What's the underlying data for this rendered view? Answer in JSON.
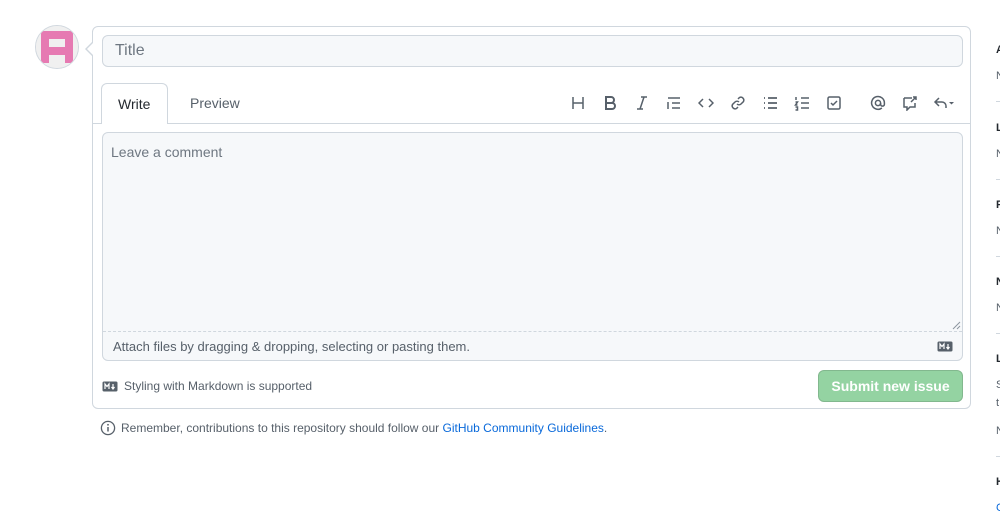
{
  "form": {
    "title_placeholder": "Title",
    "tabs": {
      "write": "Write",
      "preview": "Preview"
    },
    "toolbar_icons": [
      "heading-icon",
      "bold-icon",
      "italic-icon",
      "quote-icon",
      "code-icon",
      "link-icon",
      "unordered-list-icon",
      "ordered-list-icon",
      "task-list-icon",
      "mention-icon",
      "reference-icon",
      "reply-icon"
    ],
    "comment_placeholder": "Leave a comment",
    "attach_text": "Attach files by dragging & dropping, selecting or pasting them.",
    "markdown_hint": "Styling with Markdown is supported",
    "submit_label": "Submit new issue"
  },
  "guideline": {
    "prefix": "Remember, contributions to this repository should follow our ",
    "link": "GitHub Community Guidelines",
    "suffix": "."
  },
  "sidebar_edge": {
    "letters": [
      "A",
      "N",
      "L",
      "N",
      "P",
      "N",
      "N",
      "N",
      "L",
      "S",
      "t",
      "N",
      "H",
      "C"
    ]
  },
  "colors": {
    "submit": "#94d3a2",
    "link": "#0969da",
    "avatar": "#e67ab2"
  }
}
